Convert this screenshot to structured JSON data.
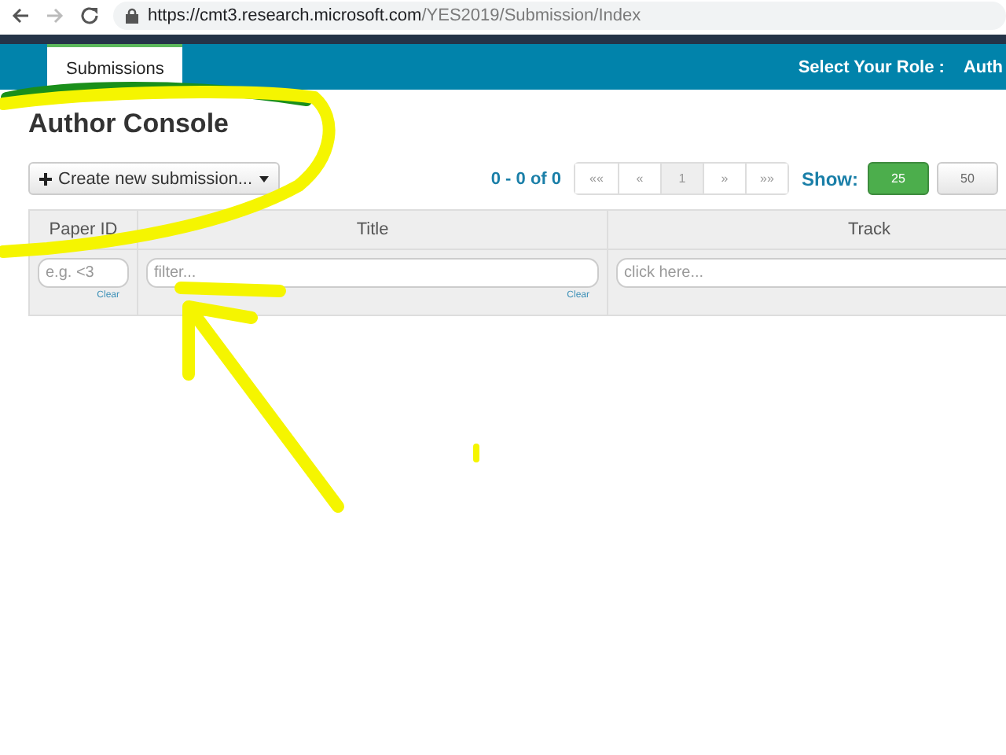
{
  "browser": {
    "url": {
      "host": "https://cmt3.research.microsoft.com",
      "path": "/YES2019/Submission/Index"
    },
    "forward_disabled": true
  },
  "nav": {
    "tabs": [
      {
        "label": "Submissions",
        "selected": true
      }
    ],
    "role_label": "Select Your Role :",
    "role_value": "Auth"
  },
  "page_title": "Author Console",
  "create_button": "Create new submission...",
  "pagination": {
    "summary": "0 - 0 of 0",
    "pages": [
      {
        "label": "««",
        "selected": false
      },
      {
        "label": "«",
        "selected": false
      },
      {
        "label": "1",
        "selected": true
      },
      {
        "label": "»",
        "selected": false
      },
      {
        "label": "»»",
        "selected": false
      }
    ],
    "show_label": "Show:",
    "sizes": [
      {
        "label": "25",
        "selected": true
      },
      {
        "label": "50",
        "selected": false
      }
    ]
  },
  "table": {
    "columns": [
      {
        "title": "Paper ID",
        "filter_placeholder": "e.g. <3",
        "clear": "Clear",
        "kind": "narrow"
      },
      {
        "title": "Title",
        "filter_placeholder": "filter...",
        "clear": "Clear",
        "kind": "wide"
      },
      {
        "title": "Track",
        "filter_placeholder": "click here...",
        "kind": "wide"
      }
    ]
  }
}
